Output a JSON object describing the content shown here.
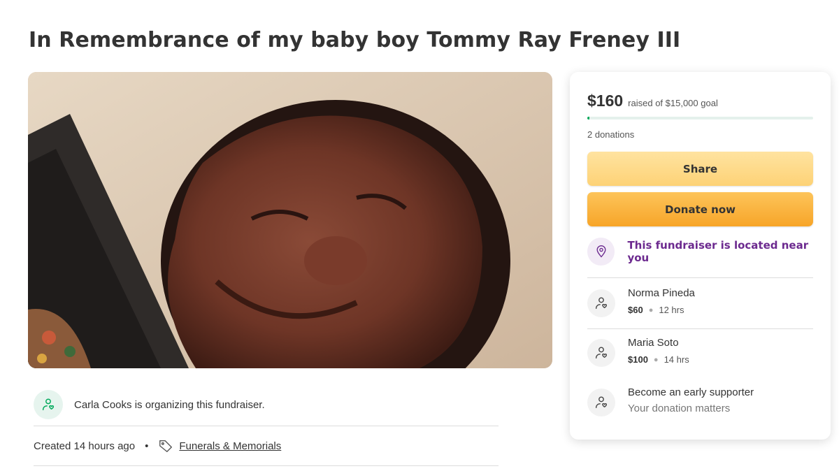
{
  "page": {
    "title": "In Remembrance of my baby boy Tommy Ray Freney III"
  },
  "organizer": {
    "text": "Carla Cooks is organizing this fundraiser.",
    "icon": "heart-hand-icon"
  },
  "meta": {
    "created": "Created 14 hours ago",
    "bullet": "•",
    "category": "Funerals & Memorials",
    "category_icon": "tag-icon"
  },
  "donation_card": {
    "raised": "$160",
    "goal_text": "raised of $15,000 goal",
    "progress_fraction": 0.0107,
    "donations_count": "2 donations",
    "share_label": "Share",
    "donate_label": "Donate now",
    "location_text": "This fundraiser is located near you",
    "donors": [
      {
        "name": "Norma Pineda",
        "amount": "$60",
        "time": "12 hrs"
      },
      {
        "name": "Maria Soto",
        "amount": "$100",
        "time": "14 hrs"
      }
    ],
    "early_supporter": {
      "title": "Become an early supporter",
      "subtitle": "Your donation matters"
    }
  },
  "colors": {
    "brand_green": "#02a95c",
    "location_purple": "#6c2a8f",
    "donate_orange": "#f7a528",
    "share_yellow": "#fdd276"
  }
}
